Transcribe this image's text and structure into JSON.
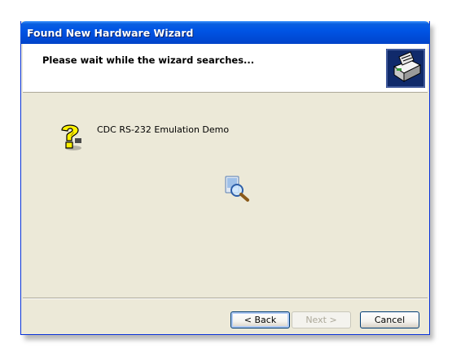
{
  "window": {
    "title": "Found New Hardware Wizard"
  },
  "header": {
    "title": "Please wait while the wizard searches...",
    "icon": "hardware-wizard-icon"
  },
  "content": {
    "device_name": "CDC RS-232 Emulation Demo",
    "device_icon": "unknown-device-question-icon",
    "search_icon": "searching-magnifier-icon"
  },
  "buttons": {
    "back": "< Back",
    "next": "Next >",
    "cancel": "Cancel"
  }
}
